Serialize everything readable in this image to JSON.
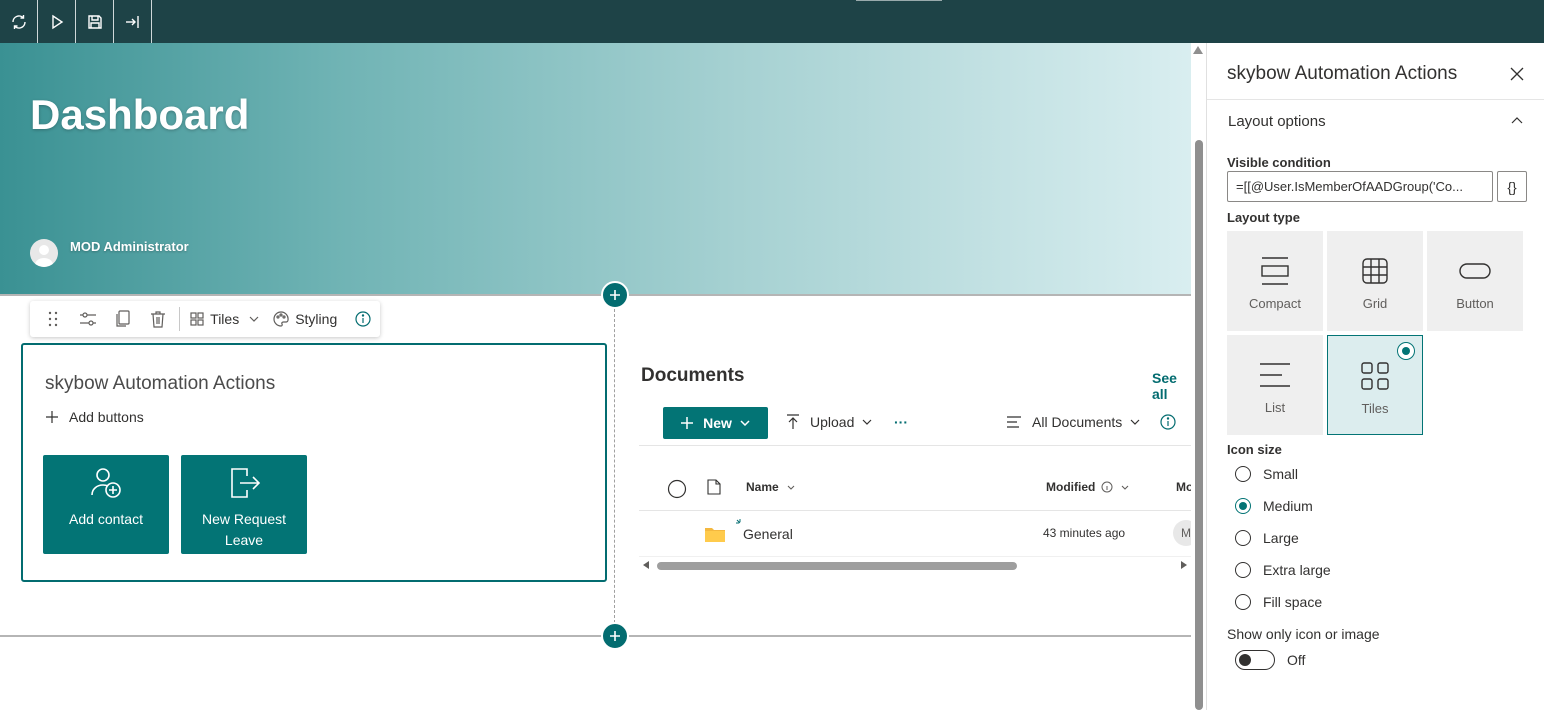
{
  "topbar": {
    "buttons": [
      {
        "icon": "refresh-icon"
      },
      {
        "icon": "play-icon"
      },
      {
        "icon": "save-icon"
      },
      {
        "icon": "exit-icon"
      }
    ]
  },
  "hero": {
    "title": "Dashboard",
    "author": "MOD Administrator"
  },
  "webpart_toolbar": {
    "layout_label": "Tiles",
    "styling_label": "Styling"
  },
  "automation": {
    "title": "skybow Automation Actions",
    "add_buttons": "Add buttons",
    "tiles": [
      {
        "label": "Add contact",
        "icon": "add-contact-icon"
      },
      {
        "label": "New Request Leave",
        "icon": "sign-out-icon"
      }
    ]
  },
  "documents": {
    "title": "Documents",
    "see_all": "See all",
    "new_label": "New",
    "upload_label": "Upload",
    "more_label": "···",
    "view_label": "All Documents",
    "columns": {
      "name": "Name",
      "modified": "Modified",
      "modified_by": "Mo"
    },
    "rows": [
      {
        "name": "General",
        "modified": "43 minutes ago",
        "modified_by": "M"
      }
    ]
  },
  "pane": {
    "title": "skybow Automation Actions",
    "group_title": "Layout options",
    "visible_condition_label": "Visible condition",
    "visible_condition_value": "=[[@User.IsMemberOfAADGroup('Co...",
    "brace_label": "{}",
    "layout_type_label": "Layout type",
    "layout_types": [
      {
        "label": "Compact",
        "icon": "compact-layout-icon"
      },
      {
        "label": "Grid",
        "icon": "grid-layout-icon"
      },
      {
        "label": "Button",
        "icon": "button-layout-icon"
      },
      {
        "label": "List",
        "icon": "list-layout-icon"
      },
      {
        "label": "Tiles",
        "icon": "tiles-layout-icon",
        "selected": true
      }
    ],
    "icon_size_label": "Icon size",
    "icon_sizes": [
      {
        "label": "Small",
        "checked": false
      },
      {
        "label": "Medium",
        "checked": true
      },
      {
        "label": "Large",
        "checked": false
      },
      {
        "label": "Extra large",
        "checked": false
      },
      {
        "label": "Fill space",
        "checked": false
      }
    ],
    "show_only_icon_label": "Show only icon or image",
    "toggle_label": "Off"
  },
  "colors": {
    "brand": "#037475",
    "topbar": "#1e4347"
  }
}
